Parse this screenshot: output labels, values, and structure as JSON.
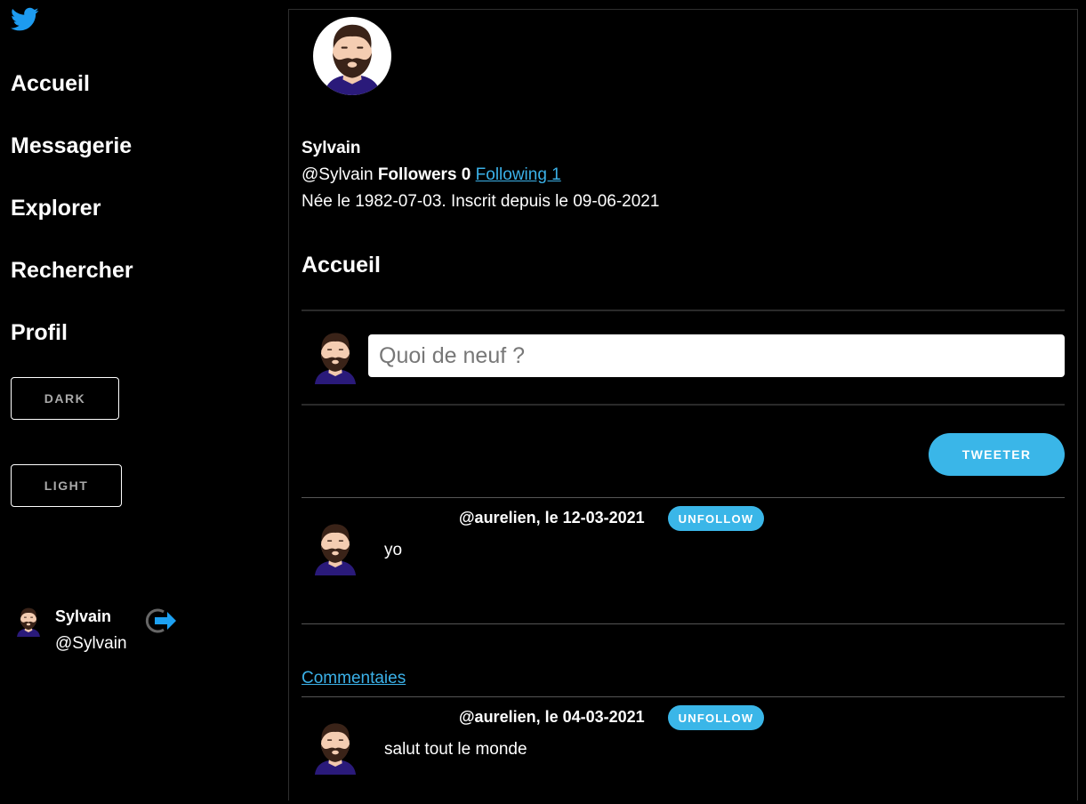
{
  "sidebar": {
    "logo_icon": "twitter-bird-icon",
    "nav": [
      "Accueil",
      "Messagerie",
      "Explorer",
      "Rechercher",
      "Profil"
    ],
    "dark_label": "DARK",
    "light_label": "LIGHT",
    "user": {
      "name": "Sylvain",
      "handle": "@Sylvain"
    },
    "logout_icon": "logout-arrow-icon"
  },
  "profile": {
    "name": "Sylvain",
    "handle": "@Sylvain",
    "followers_label": "Followers 0",
    "following_label": "Following 1",
    "bio": "Née le 1982-07-03. Inscrit depuis le 09-06-2021"
  },
  "feed": {
    "title": "Accueil",
    "compose_placeholder": "Quoi de neuf ?",
    "tweet_button": "TWEETER",
    "comments_label": "Commentaies",
    "tweets": [
      {
        "meta": "@aurelien, le 12-03-2021",
        "action": "UNFOLLOW",
        "text": "yo"
      },
      {
        "meta": "@aurelien, le 04-03-2021",
        "action": "UNFOLLOW",
        "text": "salut tout le monde"
      }
    ]
  },
  "colors": {
    "accent": "#3ab6e8",
    "link": "#3bb1e8",
    "background": "#000000"
  }
}
